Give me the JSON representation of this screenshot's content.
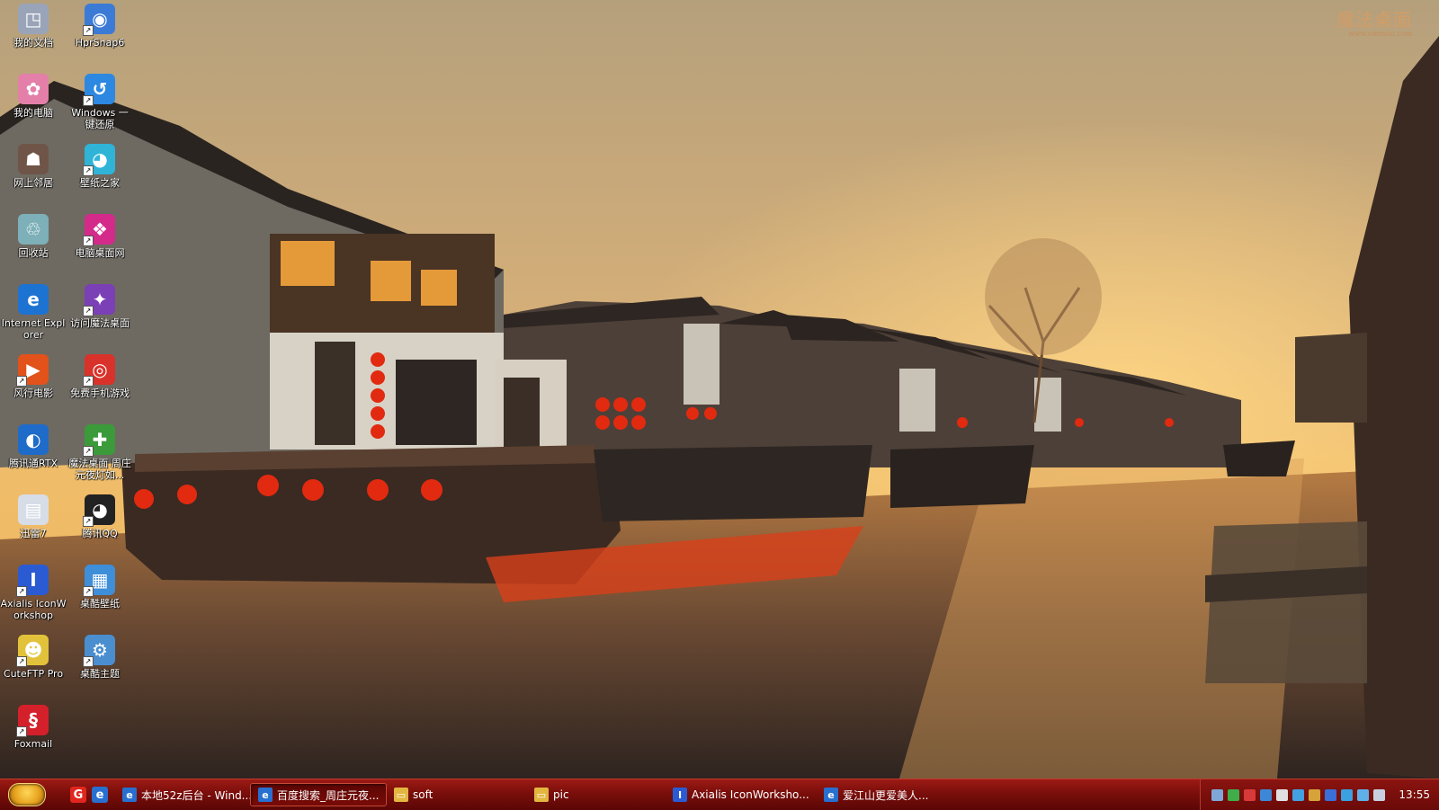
{
  "wallpaper": {
    "watermark_title": "魔法桌面",
    "watermark_url": "www.ommoo.com"
  },
  "desktop": {
    "icons": [
      {
        "label": "我的文档",
        "icon": "my-documents-icon",
        "color": "#9aa4b8",
        "glyph": "◳",
        "shortcut": false
      },
      {
        "label": "HprSnap6",
        "icon": "hypersnap-icon",
        "color": "#3b7bd6",
        "glyph": "◉",
        "shortcut": true
      },
      {
        "label": "我的电脑",
        "icon": "my-computer-icon",
        "color": "#e37fa8",
        "glyph": "✿",
        "shortcut": false
      },
      {
        "label": "Windows 一键还原",
        "icon": "onekey-restore-icon",
        "color": "#2c88e0",
        "glyph": "↺",
        "shortcut": true
      },
      {
        "label": "网上邻居",
        "icon": "network-places-icon",
        "color": "#6f5548",
        "glyph": "☗",
        "shortcut": false
      },
      {
        "label": "壁纸之家",
        "icon": "wallpaper-home-icon",
        "color": "#2fb4d8",
        "glyph": "◕",
        "shortcut": true
      },
      {
        "label": "回收站",
        "icon": "recycle-bin-icon",
        "color": "#7db0b8",
        "glyph": "♲",
        "shortcut": false
      },
      {
        "label": "电脑桌面网",
        "icon": "desktop-site-icon",
        "color": "#d42a8a",
        "glyph": "❖",
        "shortcut": true
      },
      {
        "label": "Internet Explorer",
        "icon": "internet-explorer-icon",
        "color": "#1d73d1",
        "glyph": "e",
        "shortcut": false
      },
      {
        "label": "访问魔法桌面",
        "icon": "magic-desktop-icon",
        "color": "#7b3fb6",
        "glyph": "✦",
        "shortcut": true
      },
      {
        "label": "风行电影",
        "icon": "funshion-icon",
        "color": "#e2521a",
        "glyph": "▶",
        "shortcut": true
      },
      {
        "label": "免费手机游戏",
        "icon": "mobile-games-icon",
        "color": "#d8322a",
        "glyph": "◎",
        "shortcut": true
      },
      {
        "label": "腾讯通RTX",
        "icon": "rtx-icon",
        "color": "#1f6bc9",
        "glyph": "◐",
        "shortcut": false
      },
      {
        "label": "魔法桌面 周庄元夜灯如...",
        "icon": "magic-theme-icon",
        "color": "#3b9a3a",
        "glyph": "✚",
        "shortcut": true
      },
      {
        "label": "迅雷7",
        "icon": "thunder-icon",
        "color": "#d7dde6",
        "glyph": "▤",
        "shortcut": false
      },
      {
        "label": "腾讯QQ",
        "icon": "qq-penguin-icon",
        "color": "#222222",
        "glyph": "◕",
        "shortcut": true
      },
      {
        "label": "Axialis IconWorkshop",
        "icon": "axialis-icon",
        "color": "#2a5bd3",
        "glyph": "I",
        "shortcut": true
      },
      {
        "label": "桌酷壁纸",
        "icon": "zhuoku-wallpaper-icon",
        "color": "#3e8ed8",
        "glyph": "▦",
        "shortcut": true
      },
      {
        "label": "CuteFTP Pro",
        "icon": "cuteftp-icon",
        "color": "#e2c23b",
        "glyph": "☻",
        "shortcut": true
      },
      {
        "label": "桌酷主题",
        "icon": "zhuoku-theme-icon",
        "color": "#4a8ed0",
        "glyph": "⚙",
        "shortcut": true
      },
      {
        "label": "Foxmail",
        "icon": "foxmail-icon",
        "color": "#d4202a",
        "glyph": "§",
        "shortcut": true
      }
    ]
  },
  "taskbar": {
    "start_icon": "start-orb-icon",
    "quick_launch": [
      {
        "icon": "red-app-icon",
        "glyph": "G",
        "color": "#e0261f"
      },
      {
        "icon": "ie-refresh-icon",
        "glyph": "e",
        "color": "#2870d0"
      }
    ],
    "tasks": [
      {
        "label": "本地52z后台 - Wind...",
        "icon": "internet-explorer-icon",
        "glyph": "e",
        "color": "#2870d0",
        "active": false
      },
      {
        "label": "百度搜索_周庄元夜...",
        "icon": "internet-explorer-icon",
        "glyph": "e",
        "color": "#2870d0",
        "active": true
      },
      {
        "label": "soft",
        "icon": "folder-icon",
        "glyph": "▭",
        "color": "#e3b640",
        "active": false
      },
      {
        "label": "pic",
        "icon": "folder-icon",
        "glyph": "▭",
        "color": "#e3b640",
        "active": false
      },
      {
        "label": "Axialis IconWorksho...",
        "icon": "axialis-icon",
        "glyph": "I",
        "color": "#2a5bd3",
        "active": false
      },
      {
        "label": "爱江山更爱美人...",
        "icon": "internet-explorer-icon",
        "glyph": "e",
        "color": "#2870d0",
        "active": false
      }
    ],
    "tray_icons": [
      {
        "icon": "tray-p-icon",
        "color": "#7fa8d8"
      },
      {
        "icon": "tray-leaf-icon",
        "color": "#3fae4a"
      },
      {
        "icon": "tray-shield-icon",
        "color": "#d83a3a"
      },
      {
        "icon": "tray-network-icon",
        "color": "#3c87d6"
      },
      {
        "icon": "tray-gear-icon",
        "color": "#e0e0e0"
      },
      {
        "icon": "tray-monitor-icon",
        "color": "#42a1e0"
      },
      {
        "icon": "tray-user-icon",
        "color": "#d6a23a"
      },
      {
        "icon": "tray-bear-icon",
        "color": "#3a6fd8"
      },
      {
        "icon": "tray-globe-icon",
        "color": "#3aa0e0"
      },
      {
        "icon": "tray-chat-icon",
        "color": "#5fb0e8"
      },
      {
        "icon": "tray-volume-icon",
        "color": "#c8d0e0"
      }
    ],
    "clock": "13:55"
  }
}
